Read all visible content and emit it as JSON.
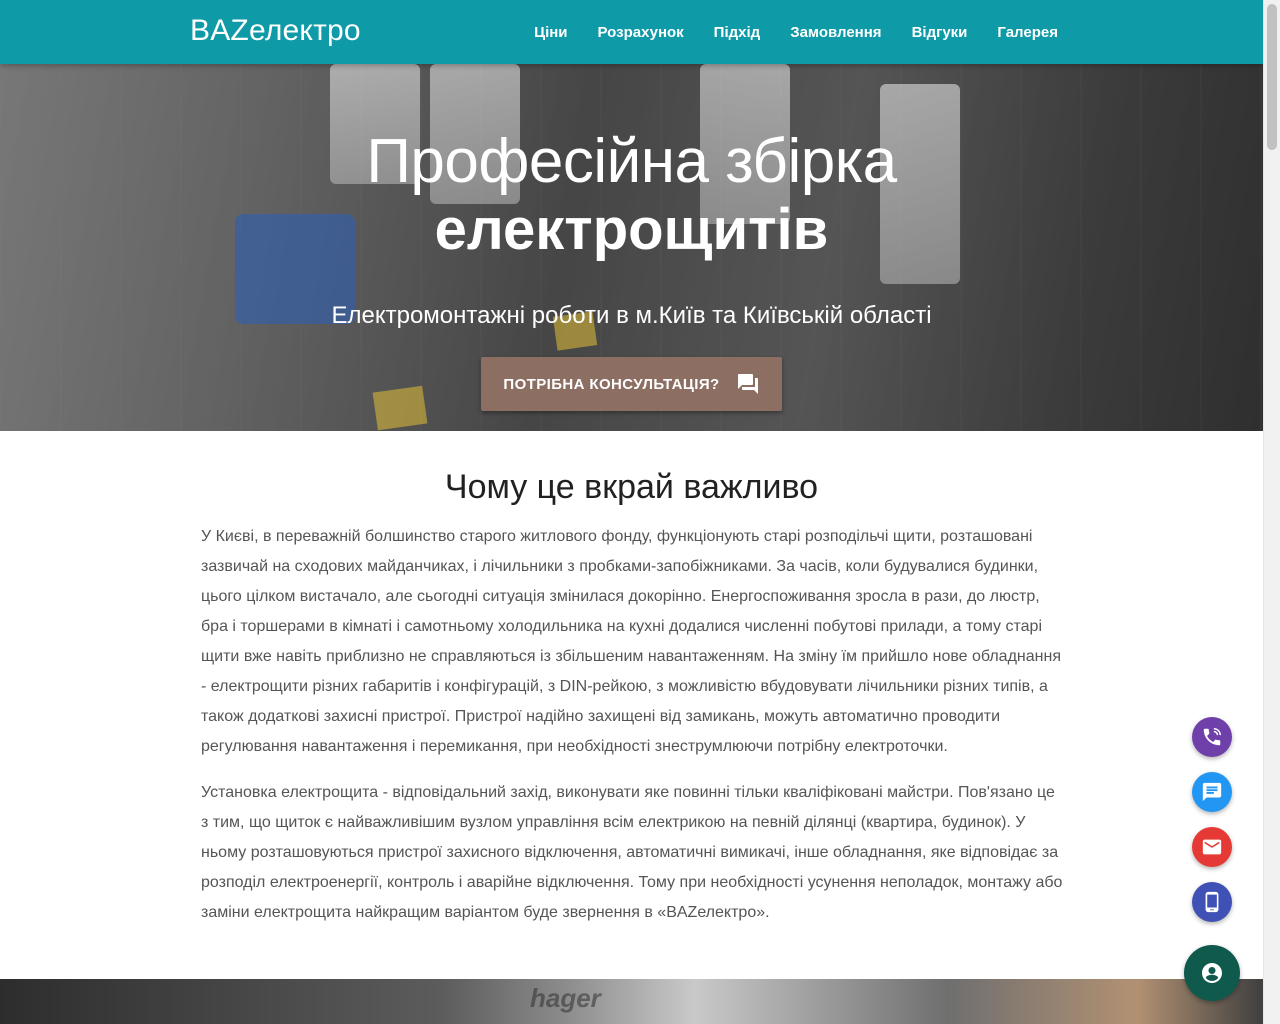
{
  "navbar": {
    "brand": "BAZелектро",
    "items": [
      "Ціни",
      "Розрахунок",
      "Підхід",
      "Замовлення",
      "Відгуки",
      "Галерея"
    ]
  },
  "hero": {
    "title_line1": "Професійна збірка",
    "title_line2": "електрощитів",
    "subtitle": "Електромонтажні роботи в м.Київ та Київській області",
    "cta_label": "ПОТРІБНА КОНСУЛЬТАЦІЯ?",
    "cta_icon": "forum-icon"
  },
  "section": {
    "title": "Чому це вкрай важливо",
    "paragraphs": [
      "У Києві, в переважній болшинство старого житлового фонду, функціонують старі розподільчі щити, розташовані зазвичай на сходових майданчиках, і лічильники з пробками-запобіжниками. За часів, коли будувалися будинки, цього цілком вистачало, але сьогодні ситуація змінилася докорінно. Енергоспоживання зросла в рази, до люстр, бра і торшерами в кімнаті і самотньому холодильника на кухні додалися численні побутові прилади, а тому старі щити вже навіть приблизно не справляються із збільшеним навантаженням. На зміну їм прийшло нове обладнання - електрощити різних габаритів і конфігурацій, з DIN-рейкою, з можливістю вбудовувати лічильники різних типів, а також додаткові захисні пристрої. Пристрої надійно захищені від замикань, можуть автоматично проводити регулювання навантаження і перемикання, при необхідності знеструмлюючи потрібну електроточки.",
      "Установка електрощита - відповідальний захід, виконувати яке повинні тільки кваліфіковані майстри. Пов'язано це з тим, що щиток є найважливішим вузлом управління всім електрикою на певній ділянці (квартира, будинок). У ньому розташовуються пристрої захисного відключення, автоматичні вимикачі, інше обладнання, яке відповідає за розподіл електроенергії, контроль і аварійне відключення. Тому при необхідності усунення неполадок, монтажу або заміни електрощита найкращим варіантом буде звернення в «BAZелектро»."
    ]
  },
  "bottom_image": {
    "label": "hager"
  },
  "fabs": [
    {
      "icon": "viber-phone-icon",
      "color": "#6f3faa"
    },
    {
      "icon": "chat-icon",
      "color": "#2196f3"
    },
    {
      "icon": "mail-icon",
      "color": "#e53935"
    },
    {
      "icon": "mobile-phone-icon",
      "color": "#3f51b5"
    },
    {
      "icon": "account-circle-icon",
      "color": "#0f5a4d"
    }
  ],
  "colors": {
    "navbar": "#0f9aa7",
    "cta": "#8d6e63"
  }
}
